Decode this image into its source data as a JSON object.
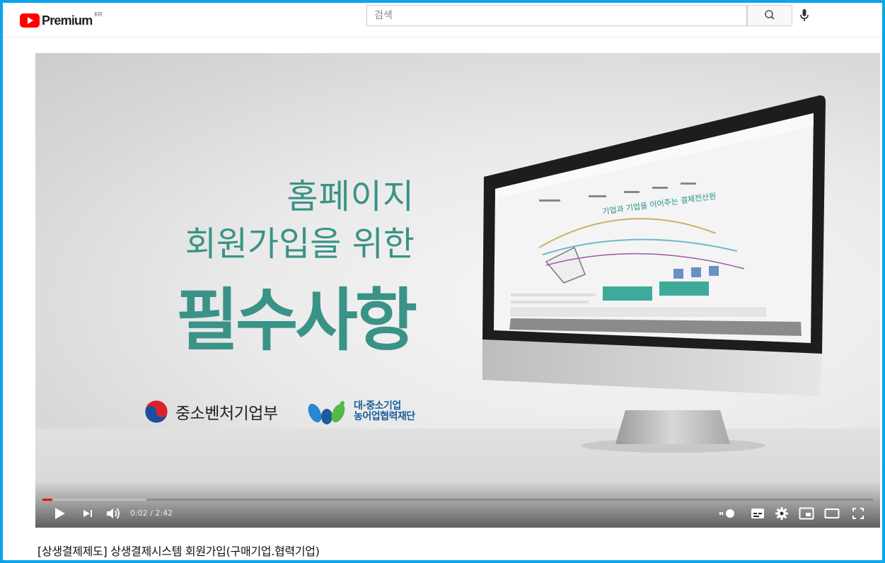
{
  "header": {
    "logo_text": "Premium",
    "region": "KR",
    "search_placeholder": "검색",
    "search_icon": "search-icon",
    "mic_icon": "mic-icon"
  },
  "video": {
    "headline_line1": "홈페이지",
    "headline_line2": "회원가입을 위한",
    "headline_line3": "필수사항",
    "ministry_name": "중소벤처기업부",
    "foundation_line1": "대·중소기업",
    "foundation_line2": "농어업협력재단",
    "screen_heading": "기업과 기업을 이어주는 결제전산원"
  },
  "player": {
    "current_time": "0:02",
    "duration": "2:42",
    "time_display": "0:02 / 2:42",
    "played_fraction": 0.012,
    "buffered_fraction": 0.125
  },
  "title": "[상생결제제도] 상생결제시스템 회원가입(구매기업.협력기업)",
  "colors": {
    "frame": "#0fa3e8",
    "headline": "#3a9387",
    "progress": "#ff0000"
  }
}
